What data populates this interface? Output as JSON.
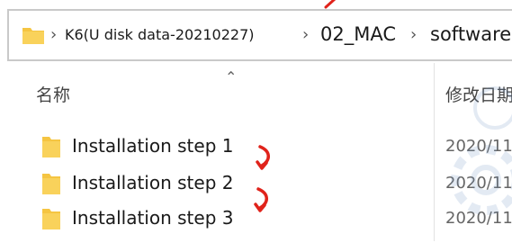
{
  "path": {
    "segments": [
      "K6(U disk data-20210227)",
      "02_MAC",
      "software"
    ],
    "separator": "›"
  },
  "columns": {
    "name": "名称",
    "date": "修改日期"
  },
  "rows": [
    {
      "name": "Installation step 1",
      "date": "2020/11"
    },
    {
      "name": "Installation step 2",
      "date": "2020/11"
    },
    {
      "name": "Installation step 3",
      "date": "2020/11"
    }
  ],
  "icons": {
    "folder": "folder-icon",
    "sort": "sort-up-icon",
    "annotation": "red-curved-arrow-icon"
  },
  "colors": {
    "folder": "#f5c542",
    "annotation": "#e0231b",
    "border": "#c9c9c9"
  }
}
